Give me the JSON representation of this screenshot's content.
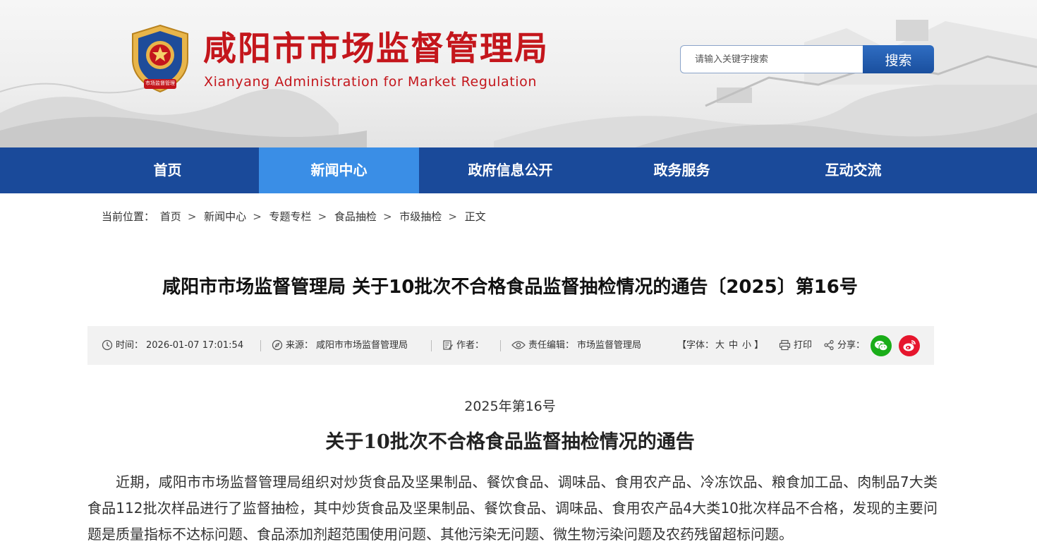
{
  "header": {
    "site_title": "咸阳市市场监督管理局",
    "site_subtitle": "Xianyang Administration for Market Regulation",
    "emblem_label": "市场监督管理",
    "search_placeholder": "请输入关键字搜索",
    "search_button": "搜索",
    "brand_color": "#c4161c"
  },
  "nav": {
    "items": [
      "首页",
      "新闻中心",
      "政府信息公开",
      "政务服务",
      "互动交流"
    ],
    "active": "新闻中心",
    "bg_color": "#1a4a9a",
    "active_color": "#3a8ee6"
  },
  "breadcrumb": {
    "prefix": "当前位置：",
    "items": [
      "首页",
      "新闻中心",
      "专题专栏",
      "食品抽检",
      "市级抽检",
      "正文"
    ],
    "separator": ">"
  },
  "article": {
    "title": "咸阳市市场监督管理局 关于10批次不合格食品监督抽检情况的通告〔2025〕第16号",
    "doc_number": "2025年第16号",
    "doc_title": "关于10批次不合格食品监督抽检情况的通告",
    "paragraph": "近期，咸阳市市场监督管理局组织对炒货食品及坚果制品、餐饮食品、调味品、食用农产品、冷冻饮品、粮食加工品、肉制品7大类食品112批次样品进行了监督抽检，其中炒货食品及坚果制品、餐饮食品、调味品、食用农产品4大类10批次样品不合格，发现的主要问题是质量指标不达标问题、食品添加剂超范围使用问题、其他污染无问题、微生物污染问题及农药残留超标问题。"
  },
  "meta": {
    "time_label": "时间：",
    "time_value": "2026-01-07 17:01:54",
    "source_label": "来源：",
    "source_value": "咸阳市市场监督管理局",
    "author_label": "作者：",
    "editor_label": "责任编辑：",
    "editor_value": "市场监督管理局",
    "font_label": "【字体：",
    "font_large": "大",
    "font_medium": "中",
    "font_small": "小",
    "font_end": "】",
    "print_label": "打印",
    "share_label": "分享："
  }
}
